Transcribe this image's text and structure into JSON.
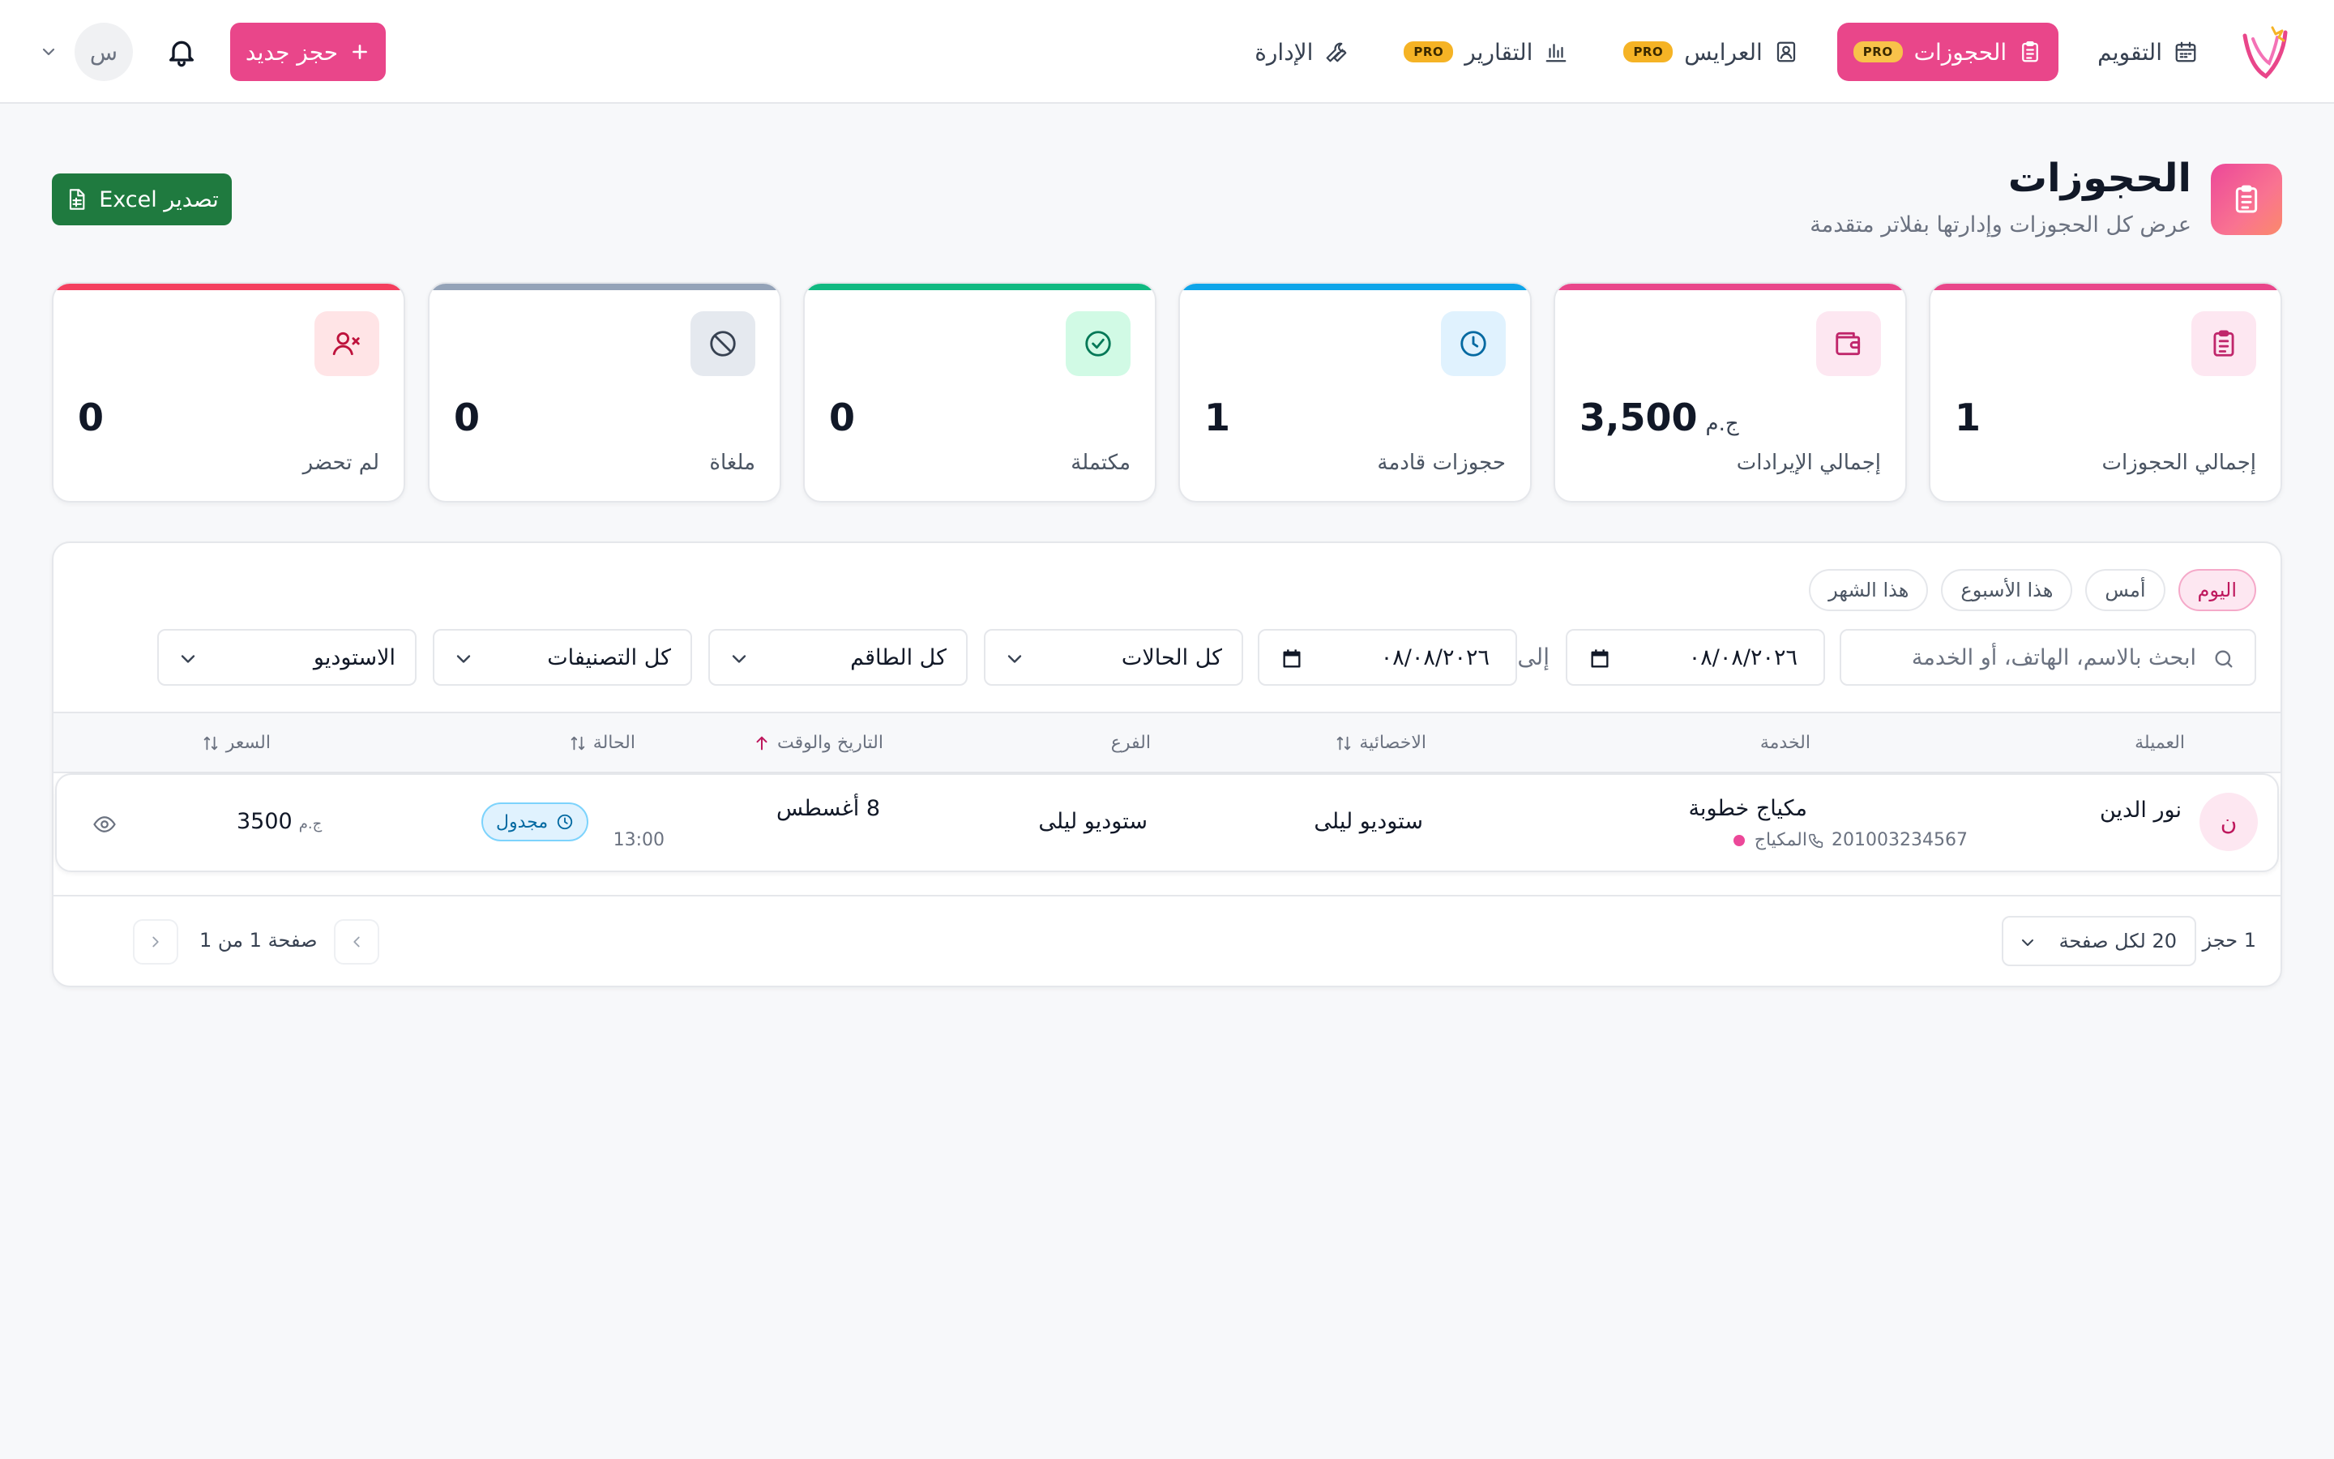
{
  "nav": {
    "items": [
      {
        "label": "التقويم",
        "pro": "",
        "active": false,
        "icon": "calendar-icon"
      },
      {
        "label": "الحجوزات",
        "pro": "PRO",
        "active": true,
        "icon": "clipboard-icon"
      },
      {
        "label": "العرايس",
        "pro": "PRO",
        "active": false,
        "icon": "contact-card-icon"
      },
      {
        "label": "التقارير",
        "pro": "PRO",
        "active": false,
        "icon": "bar-chart-icon"
      },
      {
        "label": "الإدارة",
        "pro": "",
        "active": false,
        "icon": "wrench-icon"
      }
    ],
    "new_booking_label": "حجز جديد",
    "avatar_initial": "س",
    "accent": "#e9468a"
  },
  "page": {
    "title": "الحجوزات",
    "subtitle": "عرض كل الحجوزات وإدارتها بفلاتر متقدمة",
    "export_label": "تصدير Excel"
  },
  "stats": [
    {
      "label": "إجمالي الحجوزات",
      "value": "1",
      "currency": "",
      "color": "#e9468a",
      "icon": "clipboard-icon"
    },
    {
      "label": "إجمالي الإيرادات",
      "value": "3,500",
      "currency": "ج.م",
      "color": "#e9468a",
      "icon": "wallet-icon"
    },
    {
      "label": "حجوزات قادمة",
      "value": "1",
      "currency": "",
      "color": "#0ea5e9",
      "icon": "clock-icon"
    },
    {
      "label": "مكتملة",
      "value": "0",
      "currency": "",
      "color": "#10b981",
      "icon": "check-circle-icon"
    },
    {
      "label": "ملغاة",
      "value": "0",
      "currency": "",
      "color": "#94a3b8",
      "icon": "ban-icon"
    },
    {
      "label": "لم تحضر",
      "value": "0",
      "currency": "",
      "color": "#f43f5e",
      "icon": "user-x-icon"
    }
  ],
  "filters": {
    "quick_ranges": [
      "اليوم",
      "أمس",
      "هذا الأسبوع",
      "هذا الشهر"
    ],
    "active_range": 0,
    "search_placeholder": "ابحث بالاسم، الهاتف، أو الخدمة",
    "date_from": "٠٨/٠٨/٢٠٢٦",
    "to_label": "إلى",
    "date_to": "٠٨/٠٨/٢٠٢٦",
    "status": "كل الحالات",
    "team": "كل الطاقم",
    "category": "كل التصنيفات",
    "studio": "الاستوديو"
  },
  "table": {
    "columns": [
      "العميلة",
      "الخدمة",
      "الاخصائية",
      "الفرع",
      "التاريخ والوقت",
      "الحالة",
      "السعر"
    ],
    "rows": [
      {
        "initial": "ن",
        "client": "نور الدين",
        "phone": "201003234567",
        "service": "مكياج خطوبة",
        "category": "المكياج",
        "specialist": "ستوديو ليلى",
        "branch": "ستوديو ليلى",
        "date": "8 أغسطس",
        "time": "13:00",
        "status": "مجدول",
        "price": "3500",
        "currency": "ج.م"
      }
    ]
  },
  "pagination": {
    "count": "1 حجز",
    "per_page": "20 لكل صفحة",
    "page_info": "صفحة 1 من 1"
  }
}
